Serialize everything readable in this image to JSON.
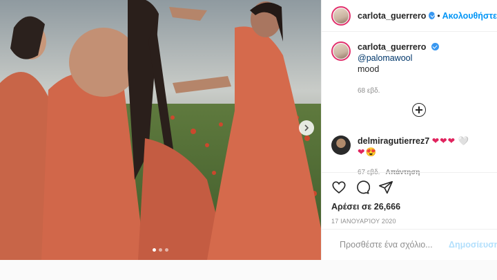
{
  "post": {
    "username": "carlota_guerrero",
    "follow_label": "Ακολουθήστε",
    "separator": "•",
    "carousel": {
      "slide_count": 3,
      "active_index": 0
    }
  },
  "caption": {
    "username": "carlota_guerrero",
    "mention": "@palomawool",
    "text": "mood",
    "time": "68 εβδ."
  },
  "comment": {
    "username": "delmiragutierrez7",
    "hearts": "❤❤❤",
    "extra": "🤍",
    "line2": "❤😍",
    "time": "67 εβδ.",
    "reply_label": "Απάντηση"
  },
  "actions": {
    "likes": "Αρέσει σε 26,666",
    "date": "17 ΙΑΝΟΥΑΡΊΟΥ 2020"
  },
  "add_comment": {
    "placeholder": "Προσθέστε ένα σχόλιο...",
    "post_label": "Δημοσίευση"
  },
  "icons": [
    "heart-icon",
    "comment-icon",
    "share-icon",
    "emoji-icon",
    "chevron-right-icon",
    "plus-circle-icon",
    "verified-icon"
  ],
  "colors": {
    "accent": "#0095f6",
    "verified": "#3897f0",
    "heart": "#e0245e",
    "dress": "#d7664a"
  }
}
